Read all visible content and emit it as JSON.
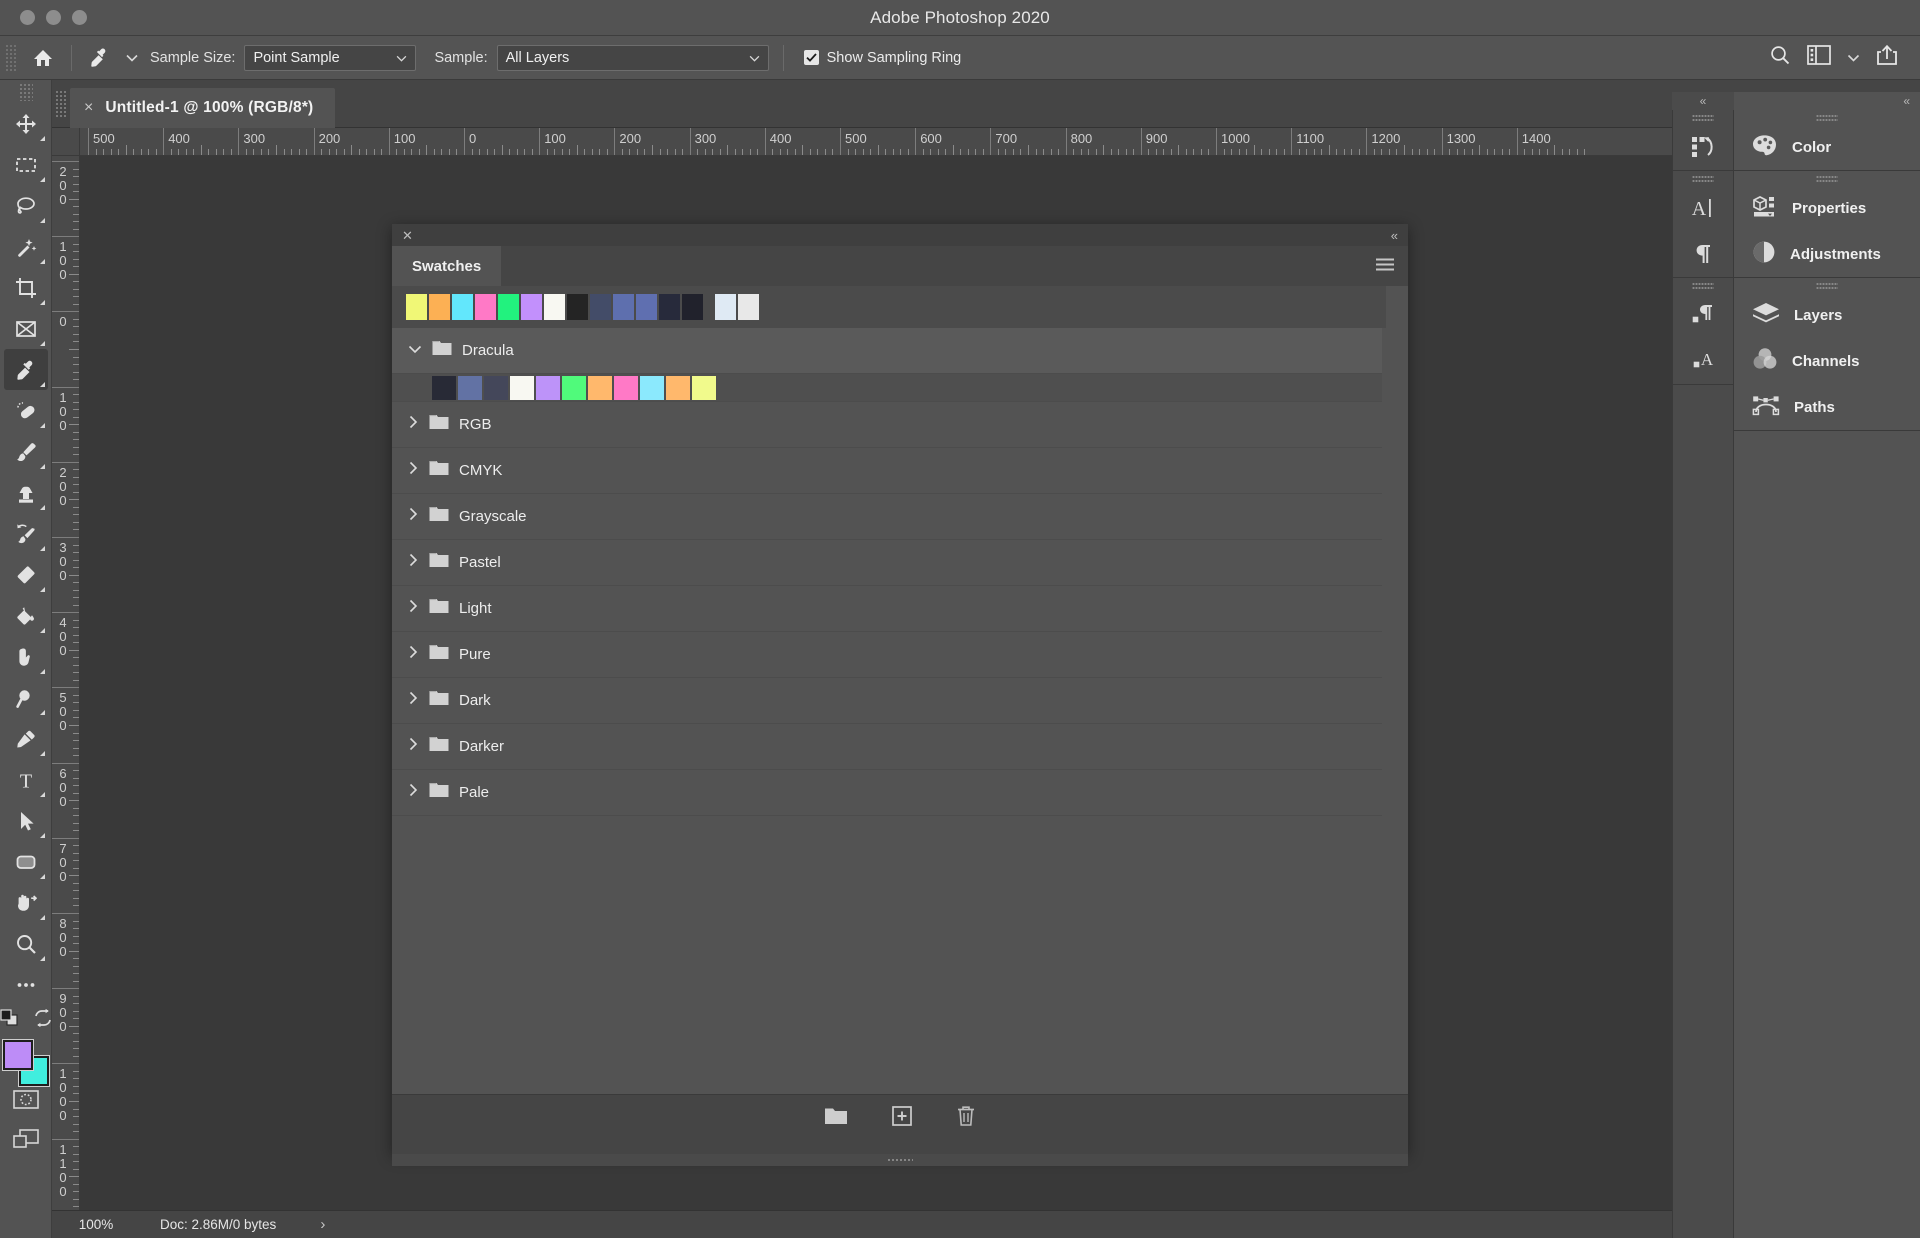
{
  "window": {
    "title": "Adobe Photoshop 2020",
    "traffic_lights": [
      "close",
      "minimize",
      "zoom"
    ]
  },
  "options_bar": {
    "home_icon": "home-icon",
    "tool_icon": "eyedropper-icon",
    "tool_preset_chevron": "chevron-down-icon",
    "sample_size_label": "Sample Size:",
    "sample_size_value": "Point Sample",
    "sample_label": "Sample:",
    "sample_value": "All Layers",
    "show_sampling_ring_label": "Show Sampling Ring",
    "show_sampling_ring_checked": true,
    "right_icons": [
      "search-icon",
      "workspace-icon",
      "chevron-down-icon",
      "share-icon"
    ]
  },
  "document_tab": {
    "close_glyph": "×",
    "name": "Untitled‑1 @ 100% (RGB/8*)"
  },
  "rulers": {
    "horizontal_labels": [
      "500",
      "400",
      "300",
      "200",
      "100",
      "0",
      "100",
      "200",
      "300",
      "400",
      "500",
      "600",
      "700",
      "800",
      "900",
      "1000",
      "1100",
      "1200",
      "1300",
      "1400"
    ],
    "vertical_labels": [
      "200",
      "100",
      "0",
      "100",
      "200",
      "300",
      "400",
      "500",
      "600",
      "700",
      "800",
      "900",
      "1000",
      "1100"
    ]
  },
  "toolbar": {
    "tools": [
      {
        "name": "move-tool",
        "icon": "move-icon",
        "active": false
      },
      {
        "name": "rectangular-marquee-tool",
        "icon": "marquee-icon",
        "active": false
      },
      {
        "name": "lasso-tool",
        "icon": "lasso-icon",
        "active": false
      },
      {
        "name": "object-selection-tool",
        "icon": "magic-wand-icon",
        "active": false
      },
      {
        "name": "crop-tool",
        "icon": "crop-icon",
        "active": false
      },
      {
        "name": "frame-tool",
        "icon": "frame-icon",
        "active": false
      },
      {
        "name": "eyedropper-tool",
        "icon": "eyedropper-icon",
        "active": true
      },
      {
        "name": "spot-healing-brush-tool",
        "icon": "healing-brush-icon",
        "active": false
      },
      {
        "name": "brush-tool",
        "icon": "brush-icon",
        "active": false
      },
      {
        "name": "clone-stamp-tool",
        "icon": "clone-stamp-icon",
        "active": false
      },
      {
        "name": "history-brush-tool",
        "icon": "history-brush-icon",
        "active": false
      },
      {
        "name": "eraser-tool",
        "icon": "eraser-icon",
        "active": false
      },
      {
        "name": "gradient-tool",
        "icon": "paint-bucket-icon",
        "active": false
      },
      {
        "name": "blur-tool",
        "icon": "blur-finger-icon",
        "active": false
      },
      {
        "name": "dodge-tool",
        "icon": "dodge-icon",
        "active": false
      },
      {
        "name": "pen-tool",
        "icon": "pen-icon",
        "active": false
      },
      {
        "name": "type-tool",
        "icon": "type-icon",
        "active": false
      },
      {
        "name": "path-selection-tool",
        "icon": "path-arrow-icon",
        "active": false
      },
      {
        "name": "rectangle-tool",
        "icon": "rounded-rectangle-icon",
        "active": false
      },
      {
        "name": "hand-tool",
        "icon": "hand-icon",
        "active": false
      },
      {
        "name": "zoom-tool",
        "icon": "magnifier-icon",
        "active": false
      },
      {
        "name": "edit-toolbar",
        "icon": "ellipsis-icon",
        "active": false
      }
    ],
    "default_colors_icon": "default-colors-icon",
    "swap_colors_icon": "swap-colors-icon",
    "foreground_color": "#bd8cf7",
    "background_color": "#40eede",
    "quick_mask_icon": "quick-mask-icon",
    "screen_mode_icon": "screen-mode-icon"
  },
  "swatches_panel": {
    "close_glyph": "✕",
    "collapse_glyph": "«",
    "tab_label": "Swatches",
    "menu_icon": "panel-menu-icon",
    "recent_colors": [
      "#f0f776",
      "#fcb054",
      "#62e7fc",
      "#ff79c6",
      "#22f27e",
      "#c290fc",
      "#f8f8f2",
      "#242424",
      "#434c68",
      "#5e6fae",
      "#5f6fb0",
      "#272a3b",
      "#21222c",
      "#dfeaf4",
      "#e8e8e8"
    ],
    "groups": [
      {
        "name": "Dracula",
        "expanded": true,
        "chevron": "chevron-down-icon",
        "swatches": [
          "#282a36",
          "#6272a4",
          "#44475a",
          "#f8f8f2",
          "#bd93f9",
          "#50fa7b",
          "#ffb86c",
          "#ff79c6",
          "#8be9fd",
          "#ffb86c",
          "#f1fa8c"
        ]
      },
      {
        "name": "RGB",
        "expanded": false,
        "chevron": "chevron-right-icon",
        "swatches": []
      },
      {
        "name": "CMYK",
        "expanded": false,
        "chevron": "chevron-right-icon",
        "swatches": []
      },
      {
        "name": "Grayscale",
        "expanded": false,
        "chevron": "chevron-right-icon",
        "swatches": []
      },
      {
        "name": "Pastel",
        "expanded": false,
        "chevron": "chevron-right-icon",
        "swatches": []
      },
      {
        "name": "Light",
        "expanded": false,
        "chevron": "chevron-right-icon",
        "swatches": []
      },
      {
        "name": "Pure",
        "expanded": false,
        "chevron": "chevron-right-icon",
        "swatches": []
      },
      {
        "name": "Dark",
        "expanded": false,
        "chevron": "chevron-right-icon",
        "swatches": []
      },
      {
        "name": "Darker",
        "expanded": false,
        "chevron": "chevron-right-icon",
        "swatches": []
      },
      {
        "name": "Pale",
        "expanded": false,
        "chevron": "chevron-right-icon",
        "swatches": []
      }
    ],
    "footer_icons": [
      "new-group-folder-icon",
      "new-swatch-icon",
      "delete-swatch-icon"
    ]
  },
  "right_dock": {
    "collapse_glyph": "«",
    "icon_groups": [
      {
        "icons": [
          "history-icon"
        ]
      },
      {
        "icons": [
          "character-icon",
          "paragraph-icon"
        ]
      },
      {
        "icons": [
          "paragraph-styles-icon",
          "character-styles-icon"
        ]
      }
    ],
    "panel_groups": [
      {
        "items": [
          {
            "label": "Color",
            "icon": "color-palette-icon"
          }
        ]
      },
      {
        "items": [
          {
            "label": "Properties",
            "icon": "properties-icon"
          },
          {
            "label": "Adjustments",
            "icon": "adjustments-icon"
          }
        ]
      },
      {
        "items": [
          {
            "label": "Layers",
            "icon": "layers-icon"
          },
          {
            "label": "Channels",
            "icon": "channels-icon"
          },
          {
            "label": "Paths",
            "icon": "paths-icon"
          }
        ]
      }
    ]
  },
  "status_bar": {
    "zoom": "100%",
    "doc_info": "Doc: 2.86M/0 bytes",
    "arrow_glyph": "›"
  }
}
